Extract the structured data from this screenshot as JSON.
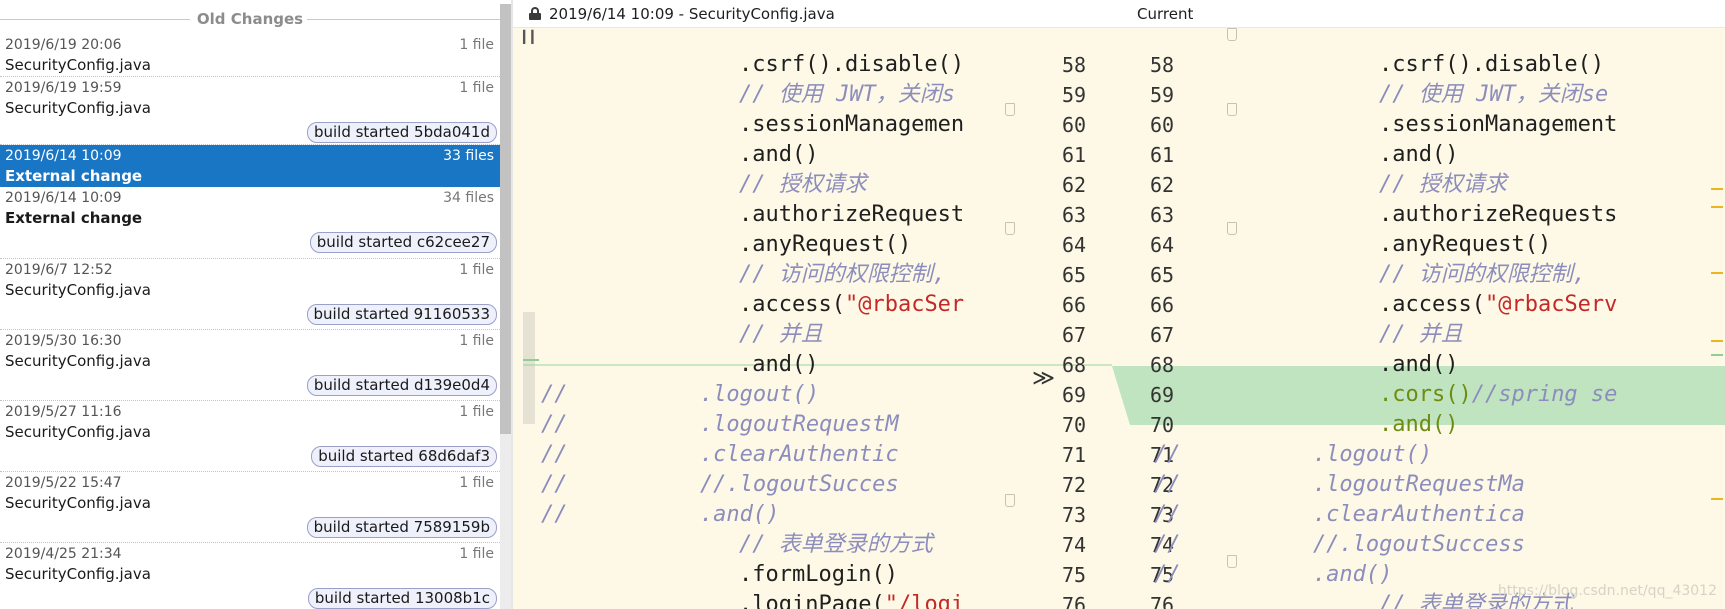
{
  "history": {
    "header": "Old Changes",
    "entries": [
      {
        "date": "2019/6/19 20:06",
        "count": "1 file",
        "name": "SecurityConfig.java",
        "badge": "",
        "bold": false,
        "selected": false
      },
      {
        "date": "2019/6/19 19:59",
        "count": "1 file",
        "name": "SecurityConfig.java",
        "badge": "build started 5bda041d",
        "bold": false,
        "selected": false
      },
      {
        "date": "2019/6/14 10:09",
        "count": "33 files",
        "name": "External change",
        "badge": "",
        "bold": true,
        "selected": true
      },
      {
        "date": "2019/6/14 10:09",
        "count": "34 files",
        "name": "External change",
        "badge": "build started c62cee27",
        "bold": true,
        "selected": false
      },
      {
        "date": "2019/6/7 12:52",
        "count": "1 file",
        "name": "SecurityConfig.java",
        "badge": "build started 91160533",
        "bold": false,
        "selected": false
      },
      {
        "date": "2019/5/30 16:30",
        "count": "1 file",
        "name": "SecurityConfig.java",
        "badge": "build started d139e0d4",
        "bold": false,
        "selected": false
      },
      {
        "date": "2019/5/27 11:16",
        "count": "1 file",
        "name": "SecurityConfig.java",
        "badge": "build started 68d6daf3",
        "bold": false,
        "selected": false
      },
      {
        "date": "2019/5/22 15:47",
        "count": "1 file",
        "name": "SecurityConfig.java",
        "badge": "build started 7589159b",
        "bold": false,
        "selected": false
      },
      {
        "date": "2019/4/25 21:34",
        "count": "1 file",
        "name": "SecurityConfig.java",
        "badge": "build started 13008b1c",
        "bold": false,
        "selected": false
      }
    ]
  },
  "diff": {
    "left_title": "2019/6/14 10:09 - SecurityConfig.java",
    "right_title": "Current",
    "left_numbers": [
      "58",
      "59",
      "60",
      "61",
      "62",
      "63",
      "64",
      "65",
      "66",
      "67",
      "68",
      "69",
      "70",
      "71",
      "72",
      "73",
      "74",
      "75",
      "76"
    ],
    "right_numbers": [
      "58",
      "59",
      "60",
      "61",
      "62",
      "63",
      "64",
      "65",
      "66",
      "67",
      "68",
      "69",
      "70",
      "71",
      "72",
      "73",
      "74",
      "75",
      "76"
    ],
    "left_lines": [
      {
        "text": ".csrf().disable()",
        "kind": "code"
      },
      {
        "text": "// 使用 JWT，关闭s",
        "kind": "comment"
      },
      {
        "text": ".sessionManagemen",
        "kind": "code"
      },
      {
        "text": ".and()",
        "kind": "code"
      },
      {
        "text": "// 授权请求",
        "kind": "comment"
      },
      {
        "text": ".authorizeRequest",
        "kind": "code"
      },
      {
        "text": ".anyRequest()",
        "kind": "code"
      },
      {
        "text": "// 访问的权限控制,",
        "kind": "comment"
      },
      {
        "text": ".access(\"@rbacSer",
        "kind": "access"
      },
      {
        "text": "// 并且",
        "kind": "comment"
      },
      {
        "text": ".and()",
        "kind": "code"
      },
      {
        "text": "//          .logout()",
        "kind": "comment-full"
      },
      {
        "text": "//          .logoutRequestM",
        "kind": "comment-full"
      },
      {
        "text": "//          .clearAuthentic",
        "kind": "comment-full"
      },
      {
        "text": "//          //.logoutSucces",
        "kind": "comment-full"
      },
      {
        "text": "//          .and()",
        "kind": "comment-full"
      },
      {
        "text": "// 表单登录的方式",
        "kind": "comment"
      },
      {
        "text": ".formLogin()",
        "kind": "code"
      },
      {
        "text": ".loginPage(\"/logi",
        "kind": "access"
      }
    ],
    "right_lines": [
      {
        "text": ".csrf().disable()",
        "kind": "code"
      },
      {
        "text": "// 使用 JWT，关闭se",
        "kind": "comment"
      },
      {
        "text": ".sessionManagement",
        "kind": "code"
      },
      {
        "text": ".and()",
        "kind": "code"
      },
      {
        "text": "// 授权请求",
        "kind": "comment"
      },
      {
        "text": ".authorizeRequests",
        "kind": "code"
      },
      {
        "text": ".anyRequest()",
        "kind": "code"
      },
      {
        "text": "// 访问的权限控制,",
        "kind": "comment"
      },
      {
        "text": ".access(\"@rbacServ",
        "kind": "access"
      },
      {
        "text": "// 并且",
        "kind": "comment"
      },
      {
        "text": ".and()",
        "kind": "code"
      },
      {
        "text": ".cors()//spring se",
        "kind": "green-comment"
      },
      {
        "text": ".and()",
        "kind": "green"
      },
      {
        "text": "//          .logout()",
        "kind": "comment-full"
      },
      {
        "text": "//          .logoutRequestMa",
        "kind": "comment-full"
      },
      {
        "text": "//          .clearAuthentica",
        "kind": "comment-full"
      },
      {
        "text": "//          //.logoutSuccess",
        "kind": "comment-full"
      },
      {
        "text": "//          .and()",
        "kind": "comment-full"
      },
      {
        "text": "// 表单登录的方式",
        "kind": "comment"
      }
    ],
    "watermark": "https://blog.csdn.net/qq_43012"
  },
  "colors": {
    "selected": "#1976c4",
    "diff_bg": "#fdf9e6",
    "inserted": "#bfe4bf",
    "comment": "#8d8dbd",
    "string": "#c62828"
  }
}
